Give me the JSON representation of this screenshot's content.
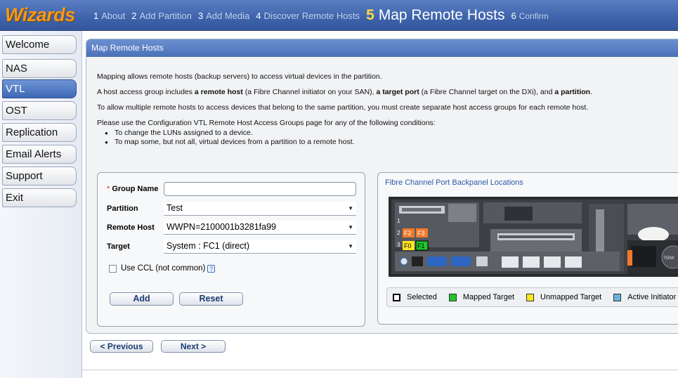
{
  "header": {
    "brand": "Wizards",
    "steps": [
      {
        "num": "1",
        "label": "About"
      },
      {
        "num": "2",
        "label": "Add Partition"
      },
      {
        "num": "3",
        "label": "Add Media"
      },
      {
        "num": "4",
        "label": "Discover Remote Hosts"
      },
      {
        "num": "5",
        "label": "Map Remote Hosts"
      },
      {
        "num": "6",
        "label": "Confirm"
      }
    ],
    "active_step": "5"
  },
  "sidebar": {
    "items": [
      {
        "label": "Welcome"
      },
      {
        "label": "NAS"
      },
      {
        "label": "VTL"
      },
      {
        "label": "OST"
      },
      {
        "label": "Replication"
      },
      {
        "label": "Email Alerts"
      },
      {
        "label": "Support"
      },
      {
        "label": "Exit"
      }
    ],
    "active": "VTL"
  },
  "panel": {
    "title": "Map Remote Hosts",
    "intro1": "Mapping allows remote hosts (backup servers) to access virtual devices in the partition.",
    "intro2_a": "A host access group includes ",
    "intro2_b": "a remote host",
    "intro2_c": " (a Fibre Channel initiator on your SAN), ",
    "intro2_d": "a target port",
    "intro2_e": " (a Fibre Channel target on the DXi), and ",
    "intro2_f": "a partition",
    "intro2_g": ".",
    "intro3": "To allow multiple remote hosts to access devices that belong to the same partition, you must create separate host access groups for each remote host.",
    "intro4": "Please use the Configuration VTL Remote Host Access Groups page for any of the following conditions:",
    "bullets": [
      "To change the LUNs assigned to a device.",
      "To map some, but not all, virtual devices from a partition to a remote host."
    ]
  },
  "form": {
    "required_mark": "*",
    "group_name_label": "Group Name",
    "group_name_value": "",
    "partition_label": "Partition",
    "partition_value": "Test",
    "remote_host_label": "Remote Host",
    "remote_host_value": "WWPN=2100001b3281fa99",
    "target_label": "Target",
    "target_value": "System : FC1 (direct)",
    "ccl_label": "Use CCL (not common)",
    "ccl_checked": false,
    "help_glyph": "?",
    "add_label": "Add",
    "reset_label": "Reset"
  },
  "fibre": {
    "title": "Fibre Channel Port Backpanel Locations",
    "ports": [
      "F2",
      "F3",
      "F0",
      "F1"
    ],
    "slot_numbers": [
      "1",
      "2",
      "3"
    ],
    "psu_label": "750W",
    "legend": [
      {
        "label": "Selected",
        "color": "#ffffff"
      },
      {
        "label": "Mapped Target",
        "color": "#22c52a"
      },
      {
        "label": "Unmapped Target",
        "color": "#ffe61f"
      },
      {
        "label": "Active Initiator",
        "color": "#6ab2d8"
      }
    ]
  },
  "nav": {
    "previous_label": "< Previous",
    "next_label": "Next >"
  },
  "colors": {
    "header_bg": "#4267b0",
    "brand": "#f39a1c",
    "active_step_num": "#ffd84a",
    "panel_header": "#5a7ec2",
    "port_orange": "#f07a2c",
    "port_yellow": "#ffe61f",
    "port_green": "#22c52a"
  }
}
